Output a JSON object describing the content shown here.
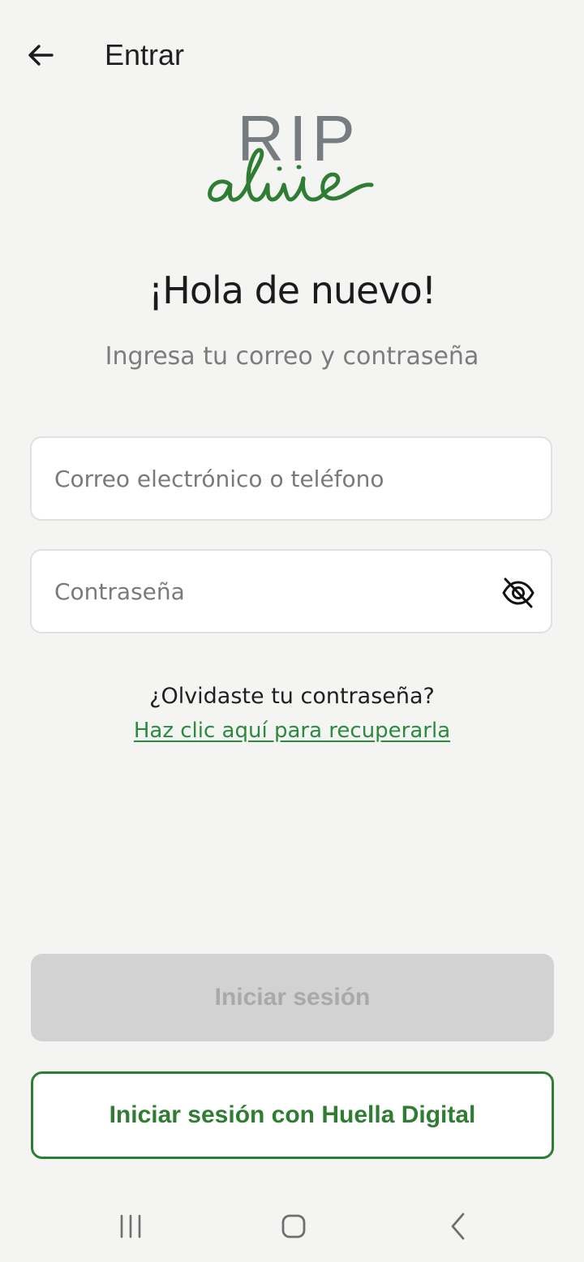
{
  "header": {
    "title": "Entrar",
    "back_icon": "arrow-left-icon"
  },
  "logo": {
    "brand_top": "RIP",
    "brand_script": "alive",
    "colors": {
      "rip": "#777c80",
      "alive": "#2e7d32"
    }
  },
  "greeting": {
    "title": "¡Hola de nuevo!",
    "subtitle": "Ingresa tu correo y contraseña"
  },
  "form": {
    "email": {
      "value": "",
      "placeholder": "Correo electrónico o teléfono"
    },
    "password": {
      "value": "",
      "placeholder": "Contraseña",
      "toggle_icon": "eye-off-icon"
    }
  },
  "recovery": {
    "question": "¿Olvidaste tu contraseña?",
    "link_label": "Haz clic aquí para recuperarla"
  },
  "actions": {
    "login_label": "Iniciar sesión",
    "login_enabled": false,
    "fingerprint_label": "Iniciar sesión con Huella Digital"
  },
  "navbar": {
    "recents_icon": "recents-icon",
    "home_icon": "home-icon",
    "back_icon": "chevron-left-icon"
  },
  "colors": {
    "background": "#f4f5f3",
    "accent": "#2e7d32",
    "link": "#2c8a3e",
    "disabled_button": "#d2d2d2",
    "disabled_text": "#a9a9a9"
  }
}
